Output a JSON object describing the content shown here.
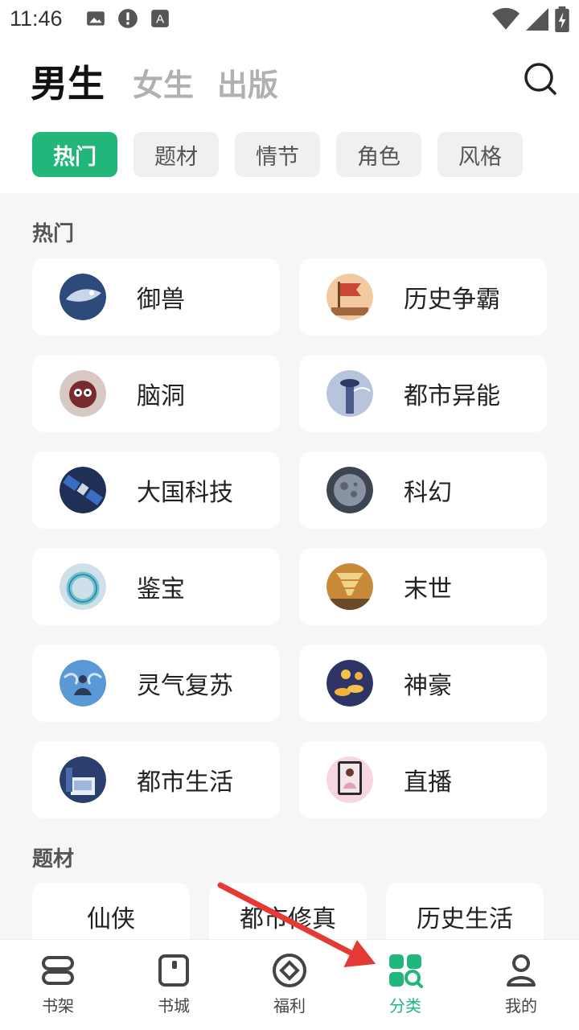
{
  "status_bar": {
    "time": "11:46",
    "left_icons": [
      "image-icon",
      "alert-icon",
      "a-icon"
    ],
    "right_icons": [
      "wifi-icon",
      "signal-icon",
      "battery-icon"
    ]
  },
  "header": {
    "tabs": [
      {
        "label": "男生",
        "active": true
      },
      {
        "label": "女生",
        "active": false
      },
      {
        "label": "出版",
        "active": false
      }
    ],
    "search_icon": "search-icon"
  },
  "chips": [
    {
      "label": "热门",
      "active": true
    },
    {
      "label": "题材",
      "active": false
    },
    {
      "label": "情节",
      "active": false
    },
    {
      "label": "角色",
      "active": false
    },
    {
      "label": "风格",
      "active": false
    }
  ],
  "hot_section": {
    "title": "热门",
    "items": [
      {
        "label": "御兽",
        "icon": "beast-icon"
      },
      {
        "label": "历史争霸",
        "icon": "flag-icon"
      },
      {
        "label": "脑洞",
        "icon": "brain-creature-icon"
      },
      {
        "label": "都市异能",
        "icon": "tower-icon"
      },
      {
        "label": "大国科技",
        "icon": "satellite-icon"
      },
      {
        "label": "科幻",
        "icon": "planet-icon"
      },
      {
        "label": "鉴宝",
        "icon": "jade-ring-icon"
      },
      {
        "label": "末世",
        "icon": "tornado-icon"
      },
      {
        "label": "灵气复苏",
        "icon": "meditation-icon"
      },
      {
        "label": "神豪",
        "icon": "gold-coins-icon"
      },
      {
        "label": "都市生活",
        "icon": "city-life-icon"
      },
      {
        "label": "直播",
        "icon": "livestream-icon"
      }
    ]
  },
  "theme_section": {
    "title": "题材",
    "items": [
      "仙侠",
      "都市修真",
      "历史生活"
    ]
  },
  "bottom_nav": [
    {
      "label": "书架",
      "icon": "bookshelf-icon",
      "active": false
    },
    {
      "label": "书城",
      "icon": "bookstore-icon",
      "active": false
    },
    {
      "label": "福利",
      "icon": "welfare-icon",
      "active": false
    },
    {
      "label": "分类",
      "icon": "category-icon",
      "active": true
    },
    {
      "label": "我的",
      "icon": "profile-icon",
      "active": false
    }
  ],
  "colors": {
    "accent": "#21b77a",
    "annotation_arrow": "#e53935"
  }
}
